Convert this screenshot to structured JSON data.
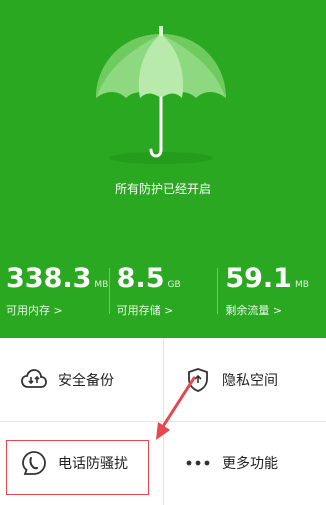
{
  "hero": {
    "status": "所有防护已经开启",
    "color": "#2aa821"
  },
  "stats": [
    {
      "value": "338.3",
      "unit": "MB",
      "label": "可用内存 >"
    },
    {
      "value": "8.5",
      "unit": "GB",
      "label": "可用存储 >"
    },
    {
      "value": "59.1",
      "unit": "MB",
      "label": "剩余流量 >"
    }
  ],
  "features": [
    {
      "label": "安全备份",
      "icon": "cloud-sync-icon"
    },
    {
      "label": "隐私空间",
      "icon": "shield-icon"
    },
    {
      "label": "电话防骚扰",
      "icon": "phone-bubble-icon"
    },
    {
      "label": "更多功能",
      "icon": "more-dots-icon"
    }
  ],
  "highlight_color": "#e5484d"
}
